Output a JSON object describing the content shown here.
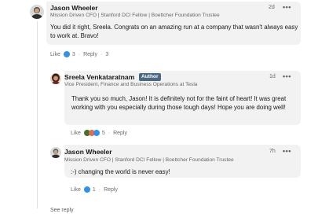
{
  "comments": [
    {
      "name": "Jason Wheeler",
      "headline": "Mission Driven CFO | Stanford DCI Fellow | Boettcher Foundation Trustee",
      "time": "2d",
      "more": "•••",
      "text": "You did it right, Sreela. Congrats on an amazing run at a company that wasn't always easy to work at. Bravo!",
      "like_label": "Like",
      "like_count": "3",
      "reply_label": "Reply",
      "reply_count": "3"
    },
    {
      "name": "Sreela Venkataratnam",
      "author_badge": "Author",
      "headline": "Vice President, Finance and Business Operations at Tesla",
      "time": "1d",
      "more": "•••",
      "text": "Thank you so much, Jason! It is definitely not for the faint of heart! It was great working with you especially during those tough days! Hope you are doing well!",
      "like_label": "Like",
      "like_count": "5",
      "reply_label": "Reply"
    },
    {
      "name": "Jason Wheeler",
      "headline": "Mission Driven CFO | Stanford DCI Fellow | Boettcher Foundation Trustee",
      "time": "7h",
      "more": "•••",
      "text": ":-) changing the world is never easy!",
      "like_label": "Like",
      "like_count": "1",
      "reply_label": "Reply"
    }
  ],
  "see_reply": "See reply",
  "colors": {
    "like_blue": "#378fe9",
    "celebrate_green": "#44712e",
    "love_red": "#df704d",
    "bubble_bg": "#f2f2f2",
    "author_badge_bg": "#4b6782"
  },
  "icons": [
    "avatar-jason",
    "avatar-sreela",
    "like-reaction-icon",
    "celebrate-reaction-icon",
    "love-reaction-icon",
    "more-options-icon"
  ]
}
